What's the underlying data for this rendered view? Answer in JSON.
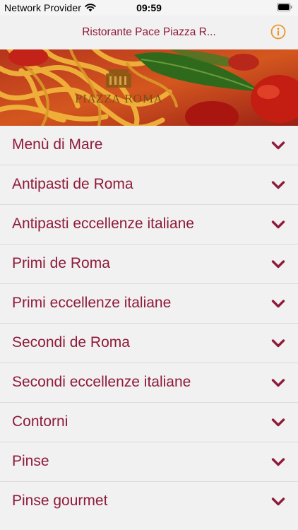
{
  "status_bar": {
    "carrier": "Network Provider",
    "time": "09:59"
  },
  "nav": {
    "title": "Ristorante Pace Piazza R...",
    "info_icon": "info-circle-icon"
  },
  "banner": {
    "logo_text": "PIAZZA ROMA"
  },
  "menu": {
    "items": [
      {
        "label": "Menù di Mare"
      },
      {
        "label": "Antipasti de Roma"
      },
      {
        "label": "Antipasti eccellenze italiane"
      },
      {
        "label": "Primi de Roma"
      },
      {
        "label": "Primi eccellenze italiane"
      },
      {
        "label": "Secondi de Roma"
      },
      {
        "label": "Secondi eccellenze italiane"
      },
      {
        "label": "Contorni"
      },
      {
        "label": "Pinse"
      },
      {
        "label": "Pinse gourmet"
      }
    ]
  },
  "colors": {
    "accent": "#8e1b3a",
    "info_icon": "#e8962e",
    "background": "#f2f1f1"
  }
}
